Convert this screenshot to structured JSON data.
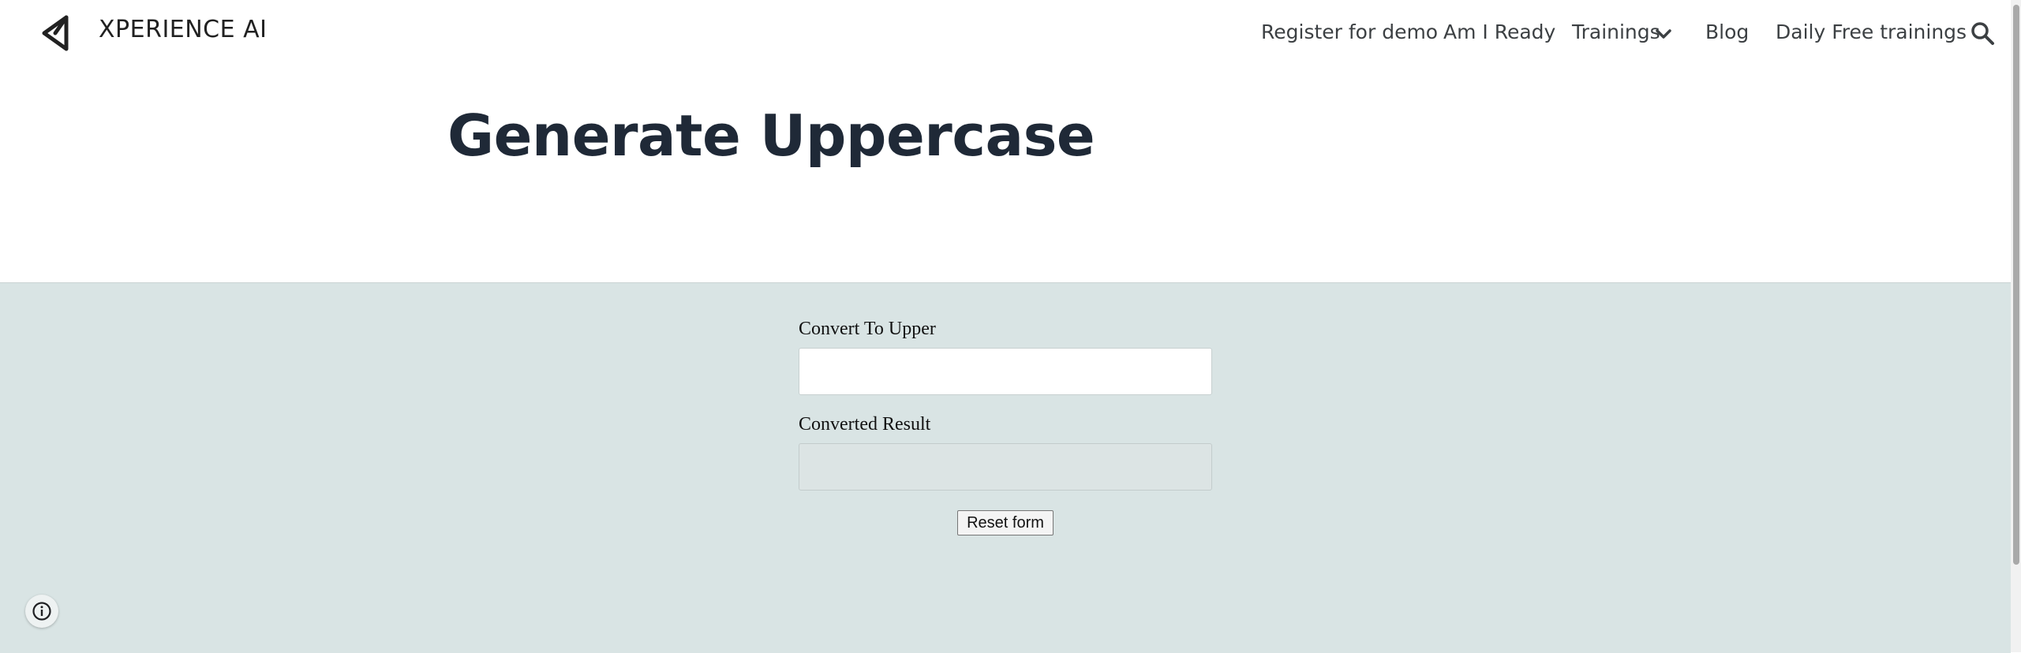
{
  "header": {
    "site_name": "XPERIENCE AI",
    "nav": {
      "register": "Register for demo",
      "am_i_ready": "Am I Ready",
      "trainings": "Trainings",
      "blog": "Blog",
      "daily_free": "Daily Free trainings"
    }
  },
  "page": {
    "title": "Generate Uppercase"
  },
  "form": {
    "input_label": "Convert To Upper",
    "input_value": "",
    "result_label": "Converted Result",
    "result_value": "",
    "reset_label": "Reset form"
  },
  "colors": {
    "form_background": "#d9e4e4",
    "title_text": "#1f2937",
    "nav_text": "#3c4043"
  },
  "icons": {
    "logo": "triangle-logo-icon",
    "trainings_dropdown": "chevron-down-icon",
    "search": "search-icon",
    "info": "info-icon"
  }
}
